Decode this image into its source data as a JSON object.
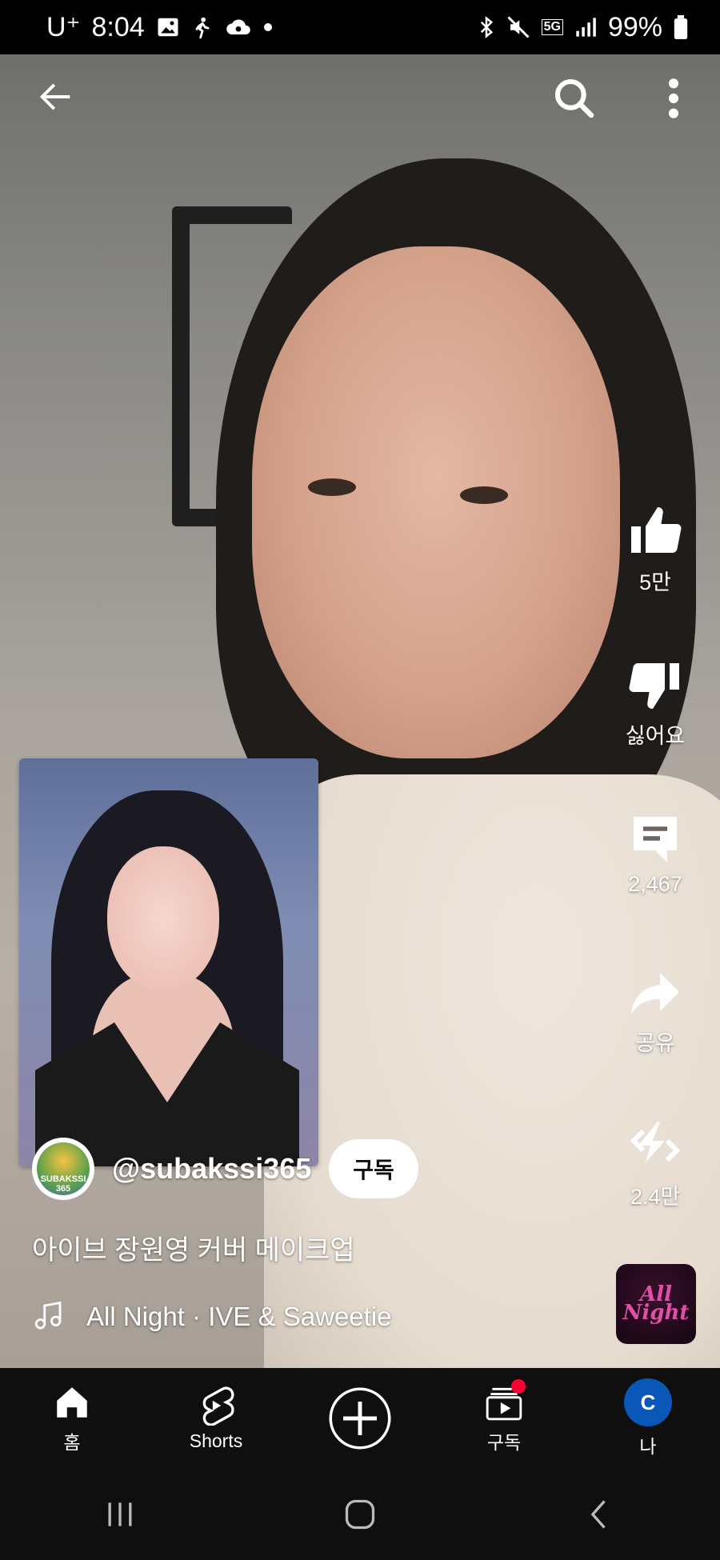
{
  "status_bar": {
    "carrier": "U⁺",
    "time": "8:04",
    "battery": "99%",
    "network": "5G"
  },
  "top_bar": {
    "back_icon": "arrow-left-icon",
    "search_icon": "search-icon",
    "more_icon": "more-vert-icon"
  },
  "actions": {
    "like_count": "5만",
    "dislike_label": "싫어요",
    "comment_count": "2,467",
    "share_label": "공유",
    "remix_count": "2.4만"
  },
  "sound_thumbnail": {
    "line1": "All",
    "line2": "Night"
  },
  "channel": {
    "handle": "@subakssi365",
    "avatar_text": "SUBAKSSI 365",
    "subscribe_label": "구독"
  },
  "video_title": "아이브 장원영 커버 메이크업",
  "music": "All Night · IVE & Saweetie",
  "bottom_nav": {
    "home": "홈",
    "shorts": "Shorts",
    "subscriptions": "구독",
    "me": "나",
    "me_initial": "C"
  },
  "colors": {
    "nav_bg": "#0f0f0f",
    "notification_dot": "#ff0033",
    "avatar_blue": "#0b57b7"
  }
}
